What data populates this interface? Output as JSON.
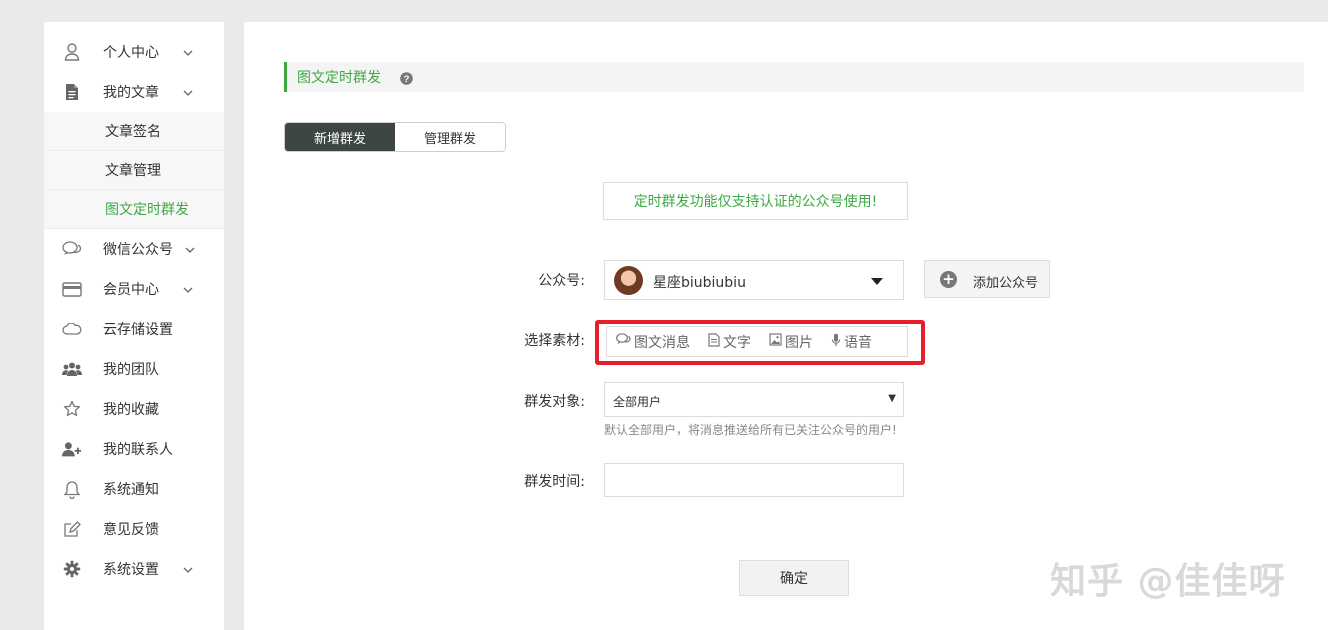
{
  "sidebar": {
    "items": [
      {
        "label": "个人中心",
        "icon": "user-icon"
      },
      {
        "label": "我的文章",
        "icon": "document-icon"
      },
      {
        "label": "微信公众号",
        "icon": "chat-icon"
      },
      {
        "label": "会员中心",
        "icon": "card-icon"
      },
      {
        "label": "云存储设置",
        "icon": "cloud-icon"
      },
      {
        "label": "我的团队",
        "icon": "team-icon"
      },
      {
        "label": "我的收藏",
        "icon": "star-icon"
      },
      {
        "label": "我的联系人",
        "icon": "add-contact-icon"
      },
      {
        "label": "系统通知",
        "icon": "bell-icon"
      },
      {
        "label": "意见反馈",
        "icon": "edit-icon"
      },
      {
        "label": "系统设置",
        "icon": "gear-icon"
      }
    ],
    "sub_items": [
      {
        "label": "文章签名",
        "active": false
      },
      {
        "label": "文章管理",
        "active": false
      },
      {
        "label": "图文定时群发",
        "active": true
      }
    ]
  },
  "page": {
    "title": "图文定时群发",
    "accent_color": "#3ea943",
    "highlight_color": "#e41e2a"
  },
  "tabs": [
    {
      "label": "新增群发",
      "active": true
    },
    {
      "label": "管理群发",
      "active": false
    }
  ],
  "notice": "定时群发功能仅支持认证的公众号使用!",
  "form": {
    "account_label": "公众号:",
    "account_value": "星座biubiubiu",
    "add_account_label": "添加公众号",
    "material_label": "选择素材:",
    "material_tabs": [
      {
        "label": "图文消息",
        "icon": "chat-bubble-icon"
      },
      {
        "label": "文字",
        "icon": "text-file-icon"
      },
      {
        "label": "图片",
        "icon": "image-icon"
      },
      {
        "label": "语音",
        "icon": "microphone-icon"
      }
    ],
    "target_label": "群发对象:",
    "target_value": "全部用户",
    "target_hint": "默认全部用户，将消息推送给所有已关注公众号的用户!",
    "time_label": "群发时间:",
    "time_value": "",
    "confirm_label": "确定"
  },
  "watermark": "知乎 @佳佳呀"
}
